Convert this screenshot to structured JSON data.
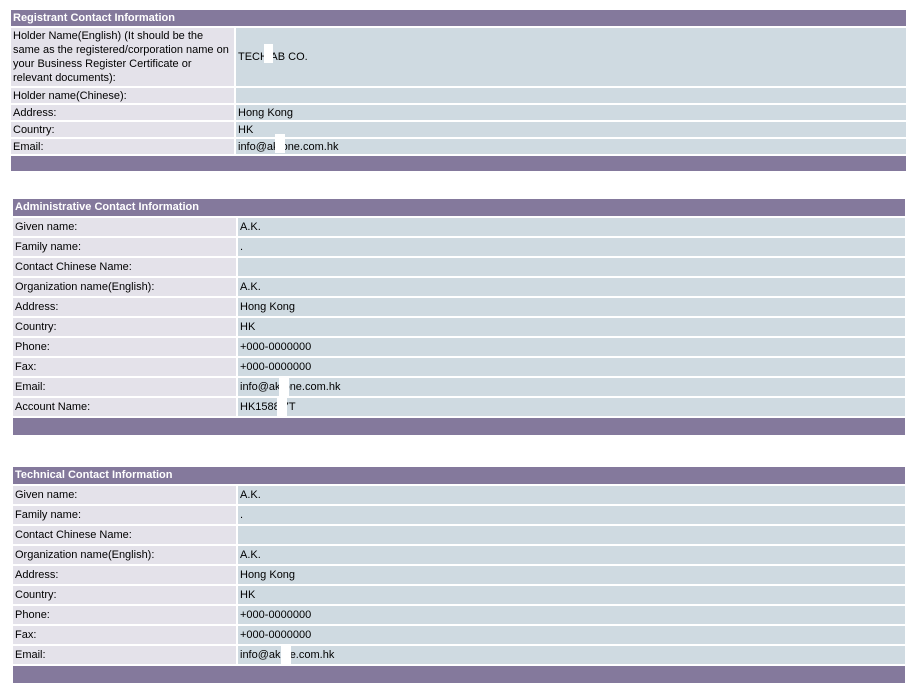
{
  "registrant": {
    "title": "Registrant Contact Information",
    "rows": [
      {
        "label": "Holder Name(English) (It should be the same as the registered/corporation name on your Business Register Certificate or relevant documents):",
        "value": "TECH  AB CO."
      },
      {
        "label": "Holder name(Chinese):",
        "value": ""
      },
      {
        "label": "Address:",
        "value": "Hong Kong"
      },
      {
        "label": "Country:",
        "value": "HK"
      },
      {
        "label": "Email:",
        "value": "info@ak   one.com.hk"
      }
    ]
  },
  "administrative": {
    "title": "Administrative Contact Information",
    "rows": [
      {
        "label": "Given name:",
        "value": "A.K."
      },
      {
        "label": "Family name:",
        "value": "."
      },
      {
        "label": "Contact Chinese Name:",
        "value": ""
      },
      {
        "label": "Organization name(English):",
        "value": "A.K."
      },
      {
        "label": "Address:",
        "value": "Hong Kong"
      },
      {
        "label": "Country:",
        "value": "HK"
      },
      {
        "label": "Phone:",
        "value": "+000-0000000"
      },
      {
        "label": "Fax:",
        "value": "+000-0000000"
      },
      {
        "label": "Email:",
        "value": "info@ak   one.com.hk"
      },
      {
        "label": "Account Name:",
        "value": "HK1588   7T"
      }
    ]
  },
  "technical": {
    "title": "Technical Contact Information",
    "rows": [
      {
        "label": "Given name:",
        "value": "A.K."
      },
      {
        "label": "Family name:",
        "value": "."
      },
      {
        "label": "Contact Chinese Name:",
        "value": ""
      },
      {
        "label": "Organization name(English):",
        "value": "A.K."
      },
      {
        "label": "Address:",
        "value": "Hong Kong"
      },
      {
        "label": "Country:",
        "value": "HK"
      },
      {
        "label": "Phone:",
        "value": "+000-0000000"
      },
      {
        "label": "Fax:",
        "value": "+000-0000000"
      },
      {
        "label": "Email:",
        "value": "info@ak   ne.com.hk"
      }
    ]
  }
}
